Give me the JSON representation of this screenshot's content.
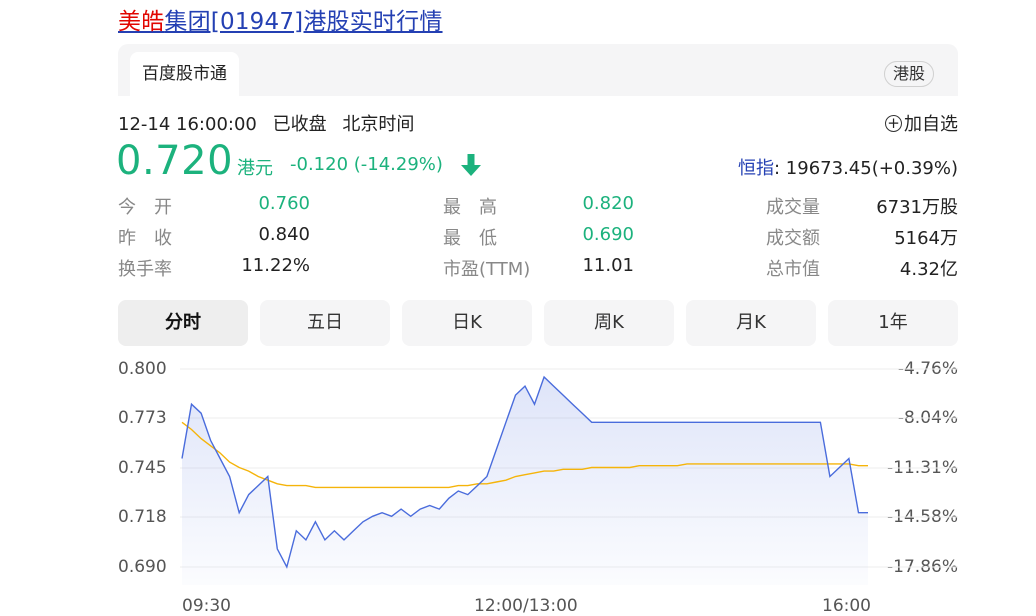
{
  "title": {
    "highlight": "美皓",
    "rest": "集团[01947]港股实时行情"
  },
  "source": {
    "tab": "百度股市通",
    "market": "港股"
  },
  "status": {
    "datetime": "12-14 16:00:00",
    "state": "已收盘",
    "timezone": "北京时间",
    "add_watch": "加自选"
  },
  "quote": {
    "price": "0.720",
    "currency": "港元",
    "change": "-0.120 (-14.29%)",
    "index_label": "恒指",
    "index_value": ": 19673.45(+0.39%)",
    "up_color": "#1cb27d"
  },
  "stats": [
    [
      {
        "label": "今　开",
        "value": "0.760",
        "green": true
      },
      {
        "label": "最　高",
        "value": "0.820",
        "green": true
      },
      {
        "label": "成交量",
        "value": "6731万股",
        "green": false
      }
    ],
    [
      {
        "label": "昨　收",
        "value": "0.840",
        "green": false
      },
      {
        "label": "最　低",
        "value": "0.690",
        "green": true
      },
      {
        "label": "成交额",
        "value": "5164万",
        "green": false
      }
    ],
    [
      {
        "label": "换手率",
        "value": "11.22%",
        "green": false
      },
      {
        "label": "市盈(TTM)",
        "value": "11.01",
        "green": false
      },
      {
        "label": "总市值",
        "value": "4.32亿",
        "green": false
      }
    ]
  ],
  "tabs": [
    "分时",
    "五日",
    "日K",
    "周K",
    "月K",
    "1年"
  ],
  "chart_data": {
    "type": "line",
    "y_left_ticks": [
      "0.800",
      "0.773",
      "0.745",
      "0.718",
      "0.690"
    ],
    "y_right_ticks": [
      "-4.76%",
      "-8.04%",
      "-11.31%",
      "-14.58%",
      "-17.86%"
    ],
    "x_ticks": [
      "09:30",
      "12:00/13:00",
      "16:00"
    ],
    "ylim": [
      0.69,
      0.8
    ],
    "series": [
      {
        "color": "#4a6cdc",
        "points": [
          [
            0,
            0.75
          ],
          [
            1,
            0.78
          ],
          [
            2,
            0.775
          ],
          [
            3,
            0.76
          ],
          [
            4,
            0.75
          ],
          [
            5,
            0.74
          ],
          [
            6,
            0.72
          ],
          [
            7,
            0.73
          ],
          [
            8,
            0.735
          ],
          [
            9,
            0.74
          ],
          [
            10,
            0.7
          ],
          [
            11,
            0.69
          ],
          [
            12,
            0.71
          ],
          [
            13,
            0.705
          ],
          [
            14,
            0.715
          ],
          [
            15,
            0.705
          ],
          [
            16,
            0.71
          ],
          [
            17,
            0.705
          ],
          [
            18,
            0.71
          ],
          [
            19,
            0.715
          ],
          [
            20,
            0.718
          ],
          [
            21,
            0.72
          ],
          [
            22,
            0.718
          ],
          [
            23,
            0.722
          ],
          [
            24,
            0.718
          ],
          [
            25,
            0.722
          ],
          [
            26,
            0.724
          ],
          [
            27,
            0.722
          ],
          [
            28,
            0.728
          ],
          [
            29,
            0.732
          ],
          [
            30,
            0.73
          ],
          [
            31,
            0.735
          ],
          [
            32,
            0.74
          ],
          [
            33,
            0.755
          ],
          [
            34,
            0.77
          ],
          [
            35,
            0.785
          ],
          [
            36,
            0.79
          ],
          [
            37,
            0.78
          ],
          [
            38,
            0.795
          ],
          [
            39,
            0.79
          ],
          [
            40,
            0.785
          ],
          [
            41,
            0.78
          ],
          [
            42,
            0.775
          ],
          [
            43,
            0.77
          ],
          [
            44,
            0.77
          ],
          [
            45,
            0.77
          ],
          [
            46,
            0.77
          ],
          [
            47,
            0.77
          ],
          [
            48,
            0.77
          ],
          [
            49,
            0.77
          ],
          [
            50,
            0.77
          ],
          [
            51,
            0.77
          ],
          [
            52,
            0.77
          ],
          [
            53,
            0.77
          ],
          [
            54,
            0.77
          ],
          [
            55,
            0.77
          ],
          [
            56,
            0.77
          ],
          [
            57,
            0.77
          ],
          [
            58,
            0.77
          ],
          [
            59,
            0.77
          ],
          [
            60,
            0.77
          ],
          [
            61,
            0.77
          ],
          [
            62,
            0.77
          ],
          [
            63,
            0.77
          ],
          [
            64,
            0.77
          ],
          [
            65,
            0.77
          ],
          [
            66,
            0.77
          ],
          [
            67,
            0.77
          ],
          [
            68,
            0.74
          ],
          [
            69,
            0.745
          ],
          [
            70,
            0.75
          ],
          [
            71,
            0.72
          ],
          [
            72,
            0.72
          ]
        ]
      },
      {
        "color": "#f5b40a",
        "points": [
          [
            0,
            0.77
          ],
          [
            1,
            0.766
          ],
          [
            2,
            0.761
          ],
          [
            3,
            0.757
          ],
          [
            4,
            0.753
          ],
          [
            5,
            0.748
          ],
          [
            6,
            0.745
          ],
          [
            7,
            0.743
          ],
          [
            8,
            0.74
          ],
          [
            9,
            0.738
          ],
          [
            10,
            0.736
          ],
          [
            11,
            0.735
          ],
          [
            12,
            0.735
          ],
          [
            13,
            0.735
          ],
          [
            14,
            0.734
          ],
          [
            15,
            0.734
          ],
          [
            16,
            0.734
          ],
          [
            17,
            0.734
          ],
          [
            18,
            0.734
          ],
          [
            19,
            0.734
          ],
          [
            20,
            0.734
          ],
          [
            21,
            0.734
          ],
          [
            22,
            0.734
          ],
          [
            23,
            0.734
          ],
          [
            24,
            0.734
          ],
          [
            25,
            0.734
          ],
          [
            26,
            0.734
          ],
          [
            27,
            0.734
          ],
          [
            28,
            0.734
          ],
          [
            29,
            0.735
          ],
          [
            30,
            0.735
          ],
          [
            31,
            0.736
          ],
          [
            32,
            0.736
          ],
          [
            33,
            0.737
          ],
          [
            34,
            0.738
          ],
          [
            35,
            0.74
          ],
          [
            36,
            0.741
          ],
          [
            37,
            0.742
          ],
          [
            38,
            0.743
          ],
          [
            39,
            0.743
          ],
          [
            40,
            0.744
          ],
          [
            41,
            0.744
          ],
          [
            42,
            0.744
          ],
          [
            43,
            0.745
          ],
          [
            44,
            0.745
          ],
          [
            45,
            0.745
          ],
          [
            46,
            0.745
          ],
          [
            47,
            0.745
          ],
          [
            48,
            0.746
          ],
          [
            49,
            0.746
          ],
          [
            50,
            0.746
          ],
          [
            51,
            0.746
          ],
          [
            52,
            0.746
          ],
          [
            53,
            0.747
          ],
          [
            54,
            0.747
          ],
          [
            55,
            0.747
          ],
          [
            56,
            0.747
          ],
          [
            57,
            0.747
          ],
          [
            58,
            0.747
          ],
          [
            59,
            0.747
          ],
          [
            60,
            0.747
          ],
          [
            61,
            0.747
          ],
          [
            62,
            0.747
          ],
          [
            63,
            0.747
          ],
          [
            64,
            0.747
          ],
          [
            65,
            0.747
          ],
          [
            66,
            0.747
          ],
          [
            67,
            0.747
          ],
          [
            68,
            0.747
          ],
          [
            69,
            0.747
          ],
          [
            70,
            0.747
          ],
          [
            71,
            0.746
          ],
          [
            72,
            0.746
          ]
        ]
      }
    ]
  }
}
